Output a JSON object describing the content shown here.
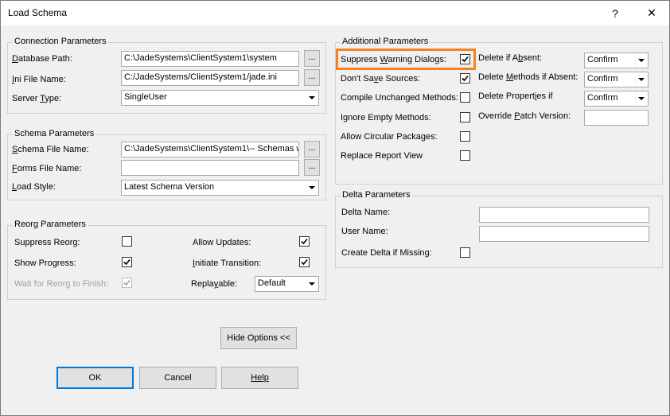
{
  "window": {
    "title": "Load Schema",
    "help_glyph": "?",
    "close_glyph": "✕"
  },
  "connection": {
    "title": "Connection Parameters",
    "database_path_pre": "",
    "database_path_u": "D",
    "database_path_post": "atabase Path:",
    "database_path_value": "C:\\JadeSystems\\ClientSystem1\\system",
    "ini_file_u": "I",
    "ini_file_post": "ni File Name:",
    "ini_file_value": "C:/JadeSystems/ClientSystem1/jade.ini",
    "server_type_pre": "Server ",
    "server_type_u": "T",
    "server_type_post": "ype:",
    "server_type_value": "SingleUser",
    "browse_label": "..."
  },
  "schema": {
    "title": "Schema Parameters",
    "schema_file_u": "S",
    "schema_file_post": "chema File Name:",
    "schema_file_value": "C:\\JadeSystems\\ClientSystem1\\-- Schemas w",
    "forms_file_u": "F",
    "forms_file_post": "orms File Name:",
    "forms_file_value": "",
    "load_style_pre": "",
    "load_style_u": "L",
    "load_style_post": "oad Style:",
    "load_style_value": "Latest Schema Version"
  },
  "reorg": {
    "title": "Reorg Parameters",
    "suppress_reorg": "Suppress Reorg:",
    "show_progress": "Show Progress:",
    "wait_for_reorg": "Wait for Reorg to Finish:",
    "allow_updates": "Allow Updates:",
    "initiate_u": "I",
    "initiate_post": "nitiate Transition:",
    "replayable_pre": "Repla",
    "replayable_u": "y",
    "replayable_post": "able:",
    "replayable_value": "Default"
  },
  "additional": {
    "title": "Additional Parameters",
    "suppress_warning_pre": "Suppress ",
    "suppress_warning_u": "W",
    "suppress_warning_post": "arning Dialogs:",
    "dont_save_pre": "Don't Sa",
    "dont_save_u": "v",
    "dont_save_post": "e Sources:",
    "compile_unchanged": "Compile Unchanged Methods:",
    "ignore_empty": "Ignore Empty Methods:",
    "allow_circular": "Allow Circular Packages:",
    "replace_report": "Replace Report View",
    "delete_absent_pre": "Delete if A",
    "delete_absent_u": "b",
    "delete_absent_post": "sent:",
    "delete_absent_value": "Confirm",
    "delete_methods_pre": "Delete ",
    "delete_methods_u": "M",
    "delete_methods_post": "ethods if Absent:",
    "delete_methods_value": "Confirm",
    "delete_props_pre": "Delete Propert",
    "delete_props_u": "i",
    "delete_props_post": "es if",
    "delete_props_value": "Confirm",
    "override_patch_pre": "Override ",
    "override_patch_u": "P",
    "override_patch_post": "atch Version:",
    "override_patch_value": ""
  },
  "delta": {
    "title": "Delta Parameters",
    "delta_name": "Delta Name:",
    "delta_name_value": "",
    "user_name": "User Name:",
    "user_name_value": "",
    "create_delta": "Create Delta if Missing:"
  },
  "buttons": {
    "hide_options": "Hide Options <<",
    "ok": "OK",
    "cancel": "Cancel",
    "help": "Help"
  },
  "colors": {
    "highlight": "#f58220",
    "background": "#f0f0f0"
  }
}
